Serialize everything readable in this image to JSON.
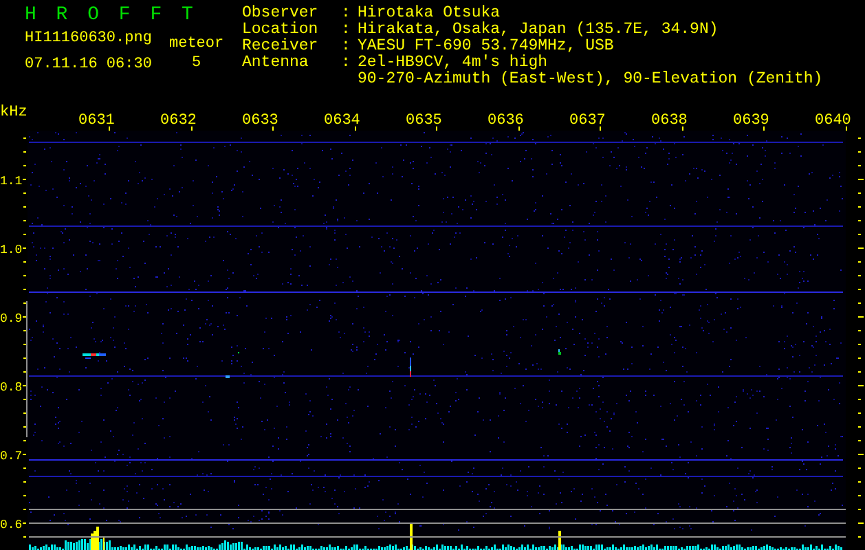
{
  "header": {
    "title": "H R O F F T",
    "filename": "HI11160630.png",
    "timestamp": "07.11.16 06:30",
    "count_label": "meteor",
    "count": "5"
  },
  "station": [
    {
      "label": "Observer",
      "sep": ":",
      "lines": [
        "Hirotaka Otsuka"
      ]
    },
    {
      "label": "Location",
      "sep": ":",
      "lines": [
        "Hirakata, Osaka, Japan (135.7E, 34.9N)"
      ]
    },
    {
      "label": "Receiver",
      "sep": ":",
      "lines": [
        "YAESU FT-690 53.749MHz, USB"
      ]
    },
    {
      "label": "Antenna",
      "sep": ":",
      "lines": [
        "2el-HB9CV, 4m's high",
        "90-270-Azimuth (East-West), 90-Elevation (Zenith)"
      ]
    }
  ],
  "spectrogram": {
    "unit": "kHz",
    "time_labels": [
      "0631",
      "0632",
      "0633",
      "0634",
      "0635",
      "0636",
      "0637",
      "0638",
      "0639",
      "0640"
    ],
    "freq_labels": [
      "1.1",
      "1.0",
      "0.9",
      "0.8",
      "0.7",
      "0.6"
    ]
  }
}
